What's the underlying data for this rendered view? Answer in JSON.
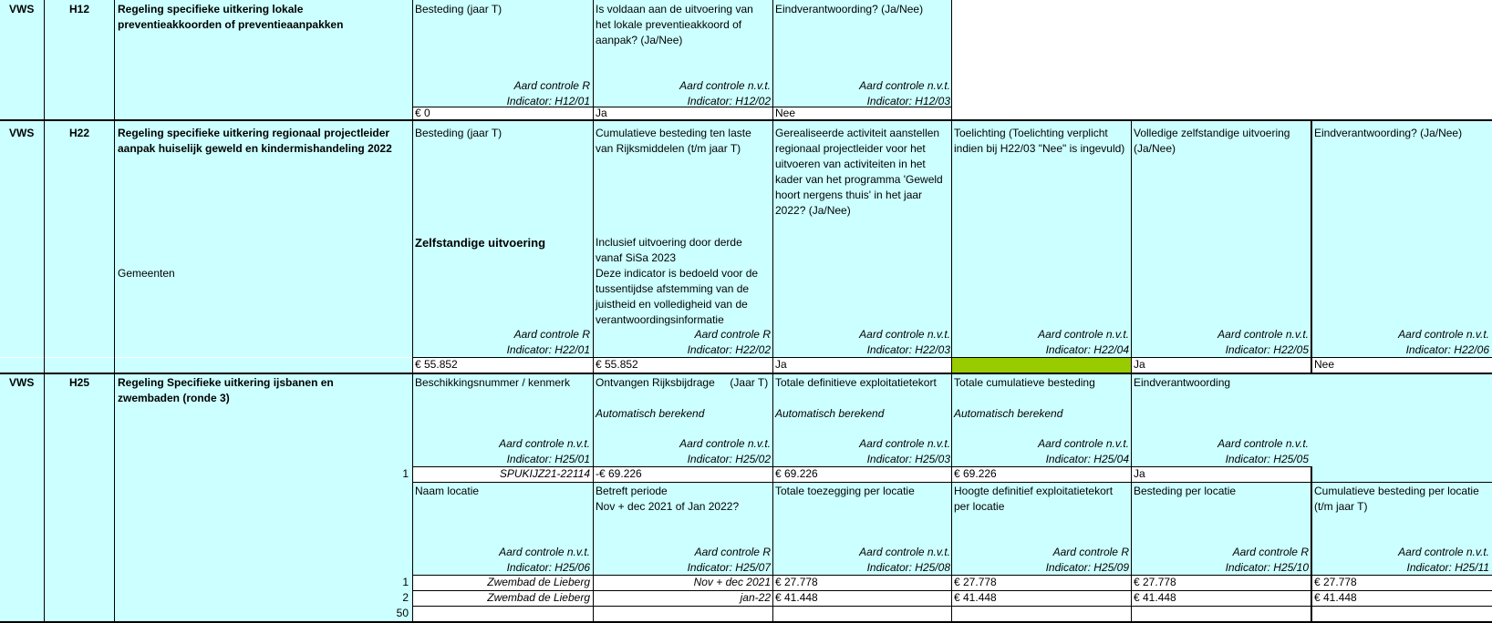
{
  "footer": {
    "aard_prefix": "Aard controle ",
    "indicator_prefix": "Indicator: "
  },
  "h12": {
    "ministry": "VWS",
    "code": "H12",
    "title": "Regeling specifieke uitkering lokale preventieakkoorden of preventieaanpakken",
    "col1": {
      "header": "Besteding (jaar T)",
      "aard": "R",
      "indicator": "H12/01",
      "value": "€ 0"
    },
    "col2": {
      "header": "Is voldaan aan de uitvoering van het lokale preventieakkoord of aanpak? (Ja/Nee)",
      "aard": "n.v.t.",
      "indicator": "H12/02",
      "value": "Ja"
    },
    "col3": {
      "header": "Eindverantwoording? (Ja/Nee)",
      "aard": "n.v.t.",
      "indicator": "H12/03",
      "value": "Nee"
    }
  },
  "h22": {
    "ministry": "VWS",
    "code": "H22",
    "title": "Regeling specifieke uitkering regionaal projectleider aanpak huiselijk geweld en kindermishandeling 2022",
    "recipient": "Gemeenten",
    "col1": {
      "header": "Besteding (jaar T)",
      "sub": "Zelfstandige uitvoering",
      "aard": "R",
      "indicator": "H22/01",
      "value": "€ 55.852"
    },
    "col2": {
      "header": "Cumulatieve besteding ten laste van Rijksmiddelen (t/m jaar T)",
      "note": "Inclusief uitvoering door derde vanaf SiSa 2023\nDeze indicator is bedoeld voor de tussentijdse afstemming van de juistheid en volledigheid van de verantwoordingsinformatie",
      "aard": "R",
      "indicator": "H22/02",
      "value": "€ 55.852"
    },
    "col3": {
      "header": "Gerealiseerde activiteit aanstellen regionaal projectleider voor het uitvoeren van activiteiten in het kader van het programma 'Geweld hoort nergens thuis' in het jaar 2022? (Ja/Nee)",
      "aard": "n.v.t.",
      "indicator": "H22/03",
      "value": "Ja"
    },
    "col4": {
      "header": "Toelichting (Toelichting verplicht indien bij H22/03 \"Nee\" is ingevuld)",
      "aard": "n.v.t.",
      "indicator": "H22/04",
      "value": ""
    },
    "col5": {
      "header": "Volledige zelfstandige uitvoering (Ja/Nee)",
      "aard": "n.v.t.",
      "indicator": "H22/05",
      "value": "Ja"
    },
    "col6": {
      "header": "Eindverantwoording? (Ja/Nee)",
      "aard": "n.v.t.",
      "indicator": "H22/06",
      "value": "Nee"
    }
  },
  "h25": {
    "ministry": "VWS",
    "code": "H25",
    "title": "Regeling Specifieke uitkering ijsbanen en zwembaden (ronde 3)",
    "top": {
      "row_number": "1",
      "col1": {
        "header": "Beschikkingsnummer / kenmerk",
        "aard": "n.v.t.",
        "indicator": "H25/01",
        "value": "SPUKIJZ21-22114"
      },
      "col2": {
        "header": "Ontvangen Rijksbijdrage     (Jaar T)",
        "auto": "Automatisch berekend",
        "aard": "n.v.t.",
        "indicator": "H25/02",
        "value": "€ 69.226"
      },
      "col3": {
        "header": "Totale definitieve exploitatietekort",
        "auto": "Automatisch berekend",
        "aard": "n.v.t.",
        "indicator": "H25/03",
        "value": "€ 69.226"
      },
      "col4": {
        "header": "Totale cumulatieve besteding",
        "auto": "Automatisch berekend",
        "aard": "n.v.t.",
        "indicator": "H25/04",
        "value": "€ 69.226"
      },
      "col5": {
        "header": "Eindverantwoording",
        "aard": "n.v.t.",
        "indicator": "H25/05",
        "value": "Ja"
      }
    },
    "bottom": {
      "col1": {
        "header": "Naam locatie",
        "aard": "n.v.t.",
        "indicator": "H25/06"
      },
      "col2": {
        "header": "Betreft periode\nNov + dec 2021 of Jan 2022?",
        "aard": "R",
        "indicator": "H25/07"
      },
      "col3": {
        "header": "Totale toezegging per locatie",
        "aard": "n.v.t.",
        "indicator": "H25/08"
      },
      "col4": {
        "header": "Hoogte definitief exploitatietekort per locatie",
        "aard": "R",
        "indicator": "H25/09"
      },
      "col5": {
        "header": "Besteding per locatie",
        "aard": "R",
        "indicator": "H25/10"
      },
      "col6": {
        "header": "Cumulatieve besteding per locatie (t/m jaar T)",
        "aard": "n.v.t.",
        "indicator": "H25/11"
      },
      "rows": [
        {
          "n": "1",
          "locatie": "Zwembad de Lieberg",
          "periode": "Nov + dec 2021",
          "toezegging": "€ 27.778",
          "tekort": "€ 27.778",
          "besteding": "€ 27.778",
          "cumulatief": "€ 27.778"
        },
        {
          "n": "2",
          "locatie": "Zwembad de Lieberg",
          "periode": "jan-22",
          "toezegging": "€ 41.448",
          "tekort": "€ 41.448",
          "besteding": "€ 41.448",
          "cumulatief": "€ 41.448"
        },
        {
          "n": "50",
          "locatie": "",
          "periode": "",
          "toezegging": "",
          "tekort": "",
          "besteding": "",
          "cumulatief": ""
        }
      ]
    }
  }
}
